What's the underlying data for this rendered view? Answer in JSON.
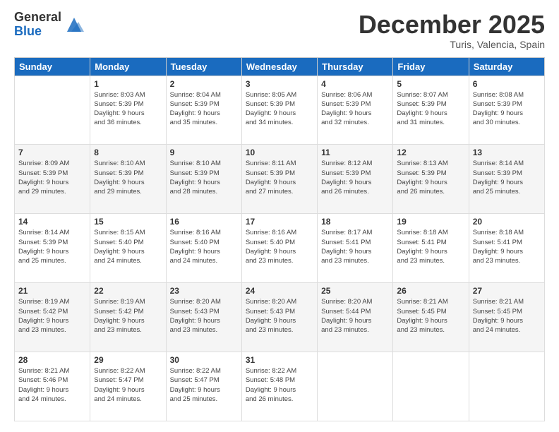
{
  "logo": {
    "general": "General",
    "blue": "Blue"
  },
  "title": "December 2025",
  "subtitle": "Turis, Valencia, Spain",
  "headers": [
    "Sunday",
    "Monday",
    "Tuesday",
    "Wednesday",
    "Thursday",
    "Friday",
    "Saturday"
  ],
  "weeks": [
    [
      {
        "day": "",
        "info": ""
      },
      {
        "day": "1",
        "info": "Sunrise: 8:03 AM\nSunset: 5:39 PM\nDaylight: 9 hours\nand 36 minutes."
      },
      {
        "day": "2",
        "info": "Sunrise: 8:04 AM\nSunset: 5:39 PM\nDaylight: 9 hours\nand 35 minutes."
      },
      {
        "day": "3",
        "info": "Sunrise: 8:05 AM\nSunset: 5:39 PM\nDaylight: 9 hours\nand 34 minutes."
      },
      {
        "day": "4",
        "info": "Sunrise: 8:06 AM\nSunset: 5:39 PM\nDaylight: 9 hours\nand 32 minutes."
      },
      {
        "day": "5",
        "info": "Sunrise: 8:07 AM\nSunset: 5:39 PM\nDaylight: 9 hours\nand 31 minutes."
      },
      {
        "day": "6",
        "info": "Sunrise: 8:08 AM\nSunset: 5:39 PM\nDaylight: 9 hours\nand 30 minutes."
      }
    ],
    [
      {
        "day": "7",
        "info": "Sunrise: 8:09 AM\nSunset: 5:39 PM\nDaylight: 9 hours\nand 29 minutes."
      },
      {
        "day": "8",
        "info": "Sunrise: 8:10 AM\nSunset: 5:39 PM\nDaylight: 9 hours\nand 29 minutes."
      },
      {
        "day": "9",
        "info": "Sunrise: 8:10 AM\nSunset: 5:39 PM\nDaylight: 9 hours\nand 28 minutes."
      },
      {
        "day": "10",
        "info": "Sunrise: 8:11 AM\nSunset: 5:39 PM\nDaylight: 9 hours\nand 27 minutes."
      },
      {
        "day": "11",
        "info": "Sunrise: 8:12 AM\nSunset: 5:39 PM\nDaylight: 9 hours\nand 26 minutes."
      },
      {
        "day": "12",
        "info": "Sunrise: 8:13 AM\nSunset: 5:39 PM\nDaylight: 9 hours\nand 26 minutes."
      },
      {
        "day": "13",
        "info": "Sunrise: 8:14 AM\nSunset: 5:39 PM\nDaylight: 9 hours\nand 25 minutes."
      }
    ],
    [
      {
        "day": "14",
        "info": "Sunrise: 8:14 AM\nSunset: 5:39 PM\nDaylight: 9 hours\nand 25 minutes."
      },
      {
        "day": "15",
        "info": "Sunrise: 8:15 AM\nSunset: 5:40 PM\nDaylight: 9 hours\nand 24 minutes."
      },
      {
        "day": "16",
        "info": "Sunrise: 8:16 AM\nSunset: 5:40 PM\nDaylight: 9 hours\nand 24 minutes."
      },
      {
        "day": "17",
        "info": "Sunrise: 8:16 AM\nSunset: 5:40 PM\nDaylight: 9 hours\nand 23 minutes."
      },
      {
        "day": "18",
        "info": "Sunrise: 8:17 AM\nSunset: 5:41 PM\nDaylight: 9 hours\nand 23 minutes."
      },
      {
        "day": "19",
        "info": "Sunrise: 8:18 AM\nSunset: 5:41 PM\nDaylight: 9 hours\nand 23 minutes."
      },
      {
        "day": "20",
        "info": "Sunrise: 8:18 AM\nSunset: 5:41 PM\nDaylight: 9 hours\nand 23 minutes."
      }
    ],
    [
      {
        "day": "21",
        "info": "Sunrise: 8:19 AM\nSunset: 5:42 PM\nDaylight: 9 hours\nand 23 minutes."
      },
      {
        "day": "22",
        "info": "Sunrise: 8:19 AM\nSunset: 5:42 PM\nDaylight: 9 hours\nand 23 minutes."
      },
      {
        "day": "23",
        "info": "Sunrise: 8:20 AM\nSunset: 5:43 PM\nDaylight: 9 hours\nand 23 minutes."
      },
      {
        "day": "24",
        "info": "Sunrise: 8:20 AM\nSunset: 5:43 PM\nDaylight: 9 hours\nand 23 minutes."
      },
      {
        "day": "25",
        "info": "Sunrise: 8:20 AM\nSunset: 5:44 PM\nDaylight: 9 hours\nand 23 minutes."
      },
      {
        "day": "26",
        "info": "Sunrise: 8:21 AM\nSunset: 5:45 PM\nDaylight: 9 hours\nand 23 minutes."
      },
      {
        "day": "27",
        "info": "Sunrise: 8:21 AM\nSunset: 5:45 PM\nDaylight: 9 hours\nand 24 minutes."
      }
    ],
    [
      {
        "day": "28",
        "info": "Sunrise: 8:21 AM\nSunset: 5:46 PM\nDaylight: 9 hours\nand 24 minutes."
      },
      {
        "day": "29",
        "info": "Sunrise: 8:22 AM\nSunset: 5:47 PM\nDaylight: 9 hours\nand 24 minutes."
      },
      {
        "day": "30",
        "info": "Sunrise: 8:22 AM\nSunset: 5:47 PM\nDaylight: 9 hours\nand 25 minutes."
      },
      {
        "day": "31",
        "info": "Sunrise: 8:22 AM\nSunset: 5:48 PM\nDaylight: 9 hours\nand 26 minutes."
      },
      {
        "day": "",
        "info": ""
      },
      {
        "day": "",
        "info": ""
      },
      {
        "day": "",
        "info": ""
      }
    ]
  ]
}
